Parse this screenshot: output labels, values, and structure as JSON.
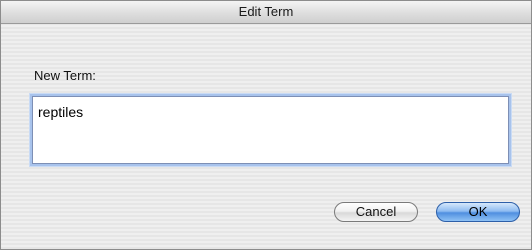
{
  "window": {
    "title": "Edit Term"
  },
  "form": {
    "label": "New Term:",
    "value": "reptiles"
  },
  "buttons": {
    "cancel_label": "Cancel",
    "ok_label": "OK"
  },
  "colors": {
    "window_background": "#ececec",
    "focus_ring": "#a8c3ec",
    "default_button": "#4f8fe0"
  }
}
